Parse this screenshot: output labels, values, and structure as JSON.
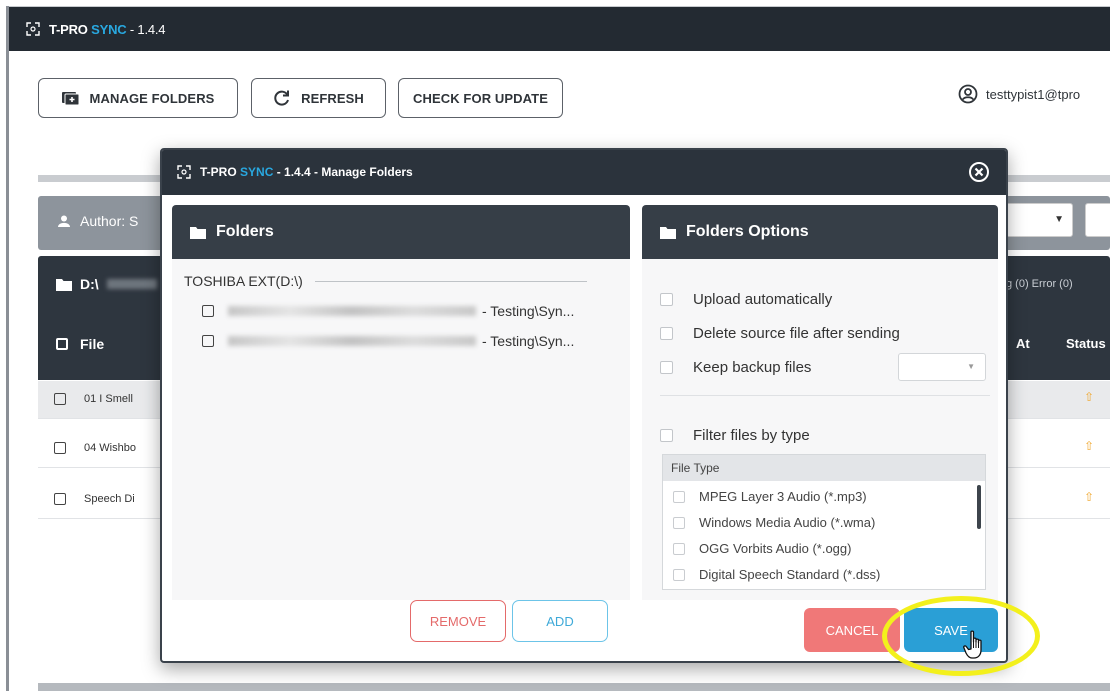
{
  "app": {
    "title_prefix": "T-PRO ",
    "title_brand": "SYNC",
    "title_version": " - 1.4.4"
  },
  "toolbar": {
    "manage_folders_label": "MANAGE FOLDERS",
    "refresh_label": "REFRESH",
    "check_update_label": "CHECK FOR UPDATE"
  },
  "user": {
    "email": "testtypist1@tpro"
  },
  "background": {
    "author_label": "Author: S",
    "folder_prefix": "D:\\",
    "counts": "g (0)  Error (0)",
    "col_file": "File",
    "col_at": "At",
    "col_status": "Status",
    "rows": [
      "01 I Smell",
      "04 Wishbo",
      "Speech Di"
    ]
  },
  "modal": {
    "title_prefix": "T-PRO ",
    "title_brand": "SYNC",
    "title_rest": " - 1.4.4 - Manage Folders",
    "folders_panel": {
      "heading": "Folders",
      "root": "TOSHIBA EXT(D:\\)",
      "items": [
        "- Testing\\Syn...",
        "- Testing\\Syn..."
      ],
      "remove_label": "REMOVE",
      "add_label": "ADD"
    },
    "options_panel": {
      "heading": "Folders Options",
      "upload_auto": "Upload automatically",
      "delete_source": "Delete source file after sending",
      "keep_backup": "Keep backup files",
      "filter_type": "Filter files by type",
      "file_type_header": "File Type",
      "file_types": [
        "MPEG Layer 3 Audio (*.mp3)",
        "Windows Media Audio (*.wma)",
        "OGG Vorbits Audio (*.ogg)",
        "Digital Speech Standard (*.dss)"
      ]
    },
    "cancel_label": "CANCEL",
    "save_label": "SAVE"
  },
  "colors": {
    "appbar": "#232a32",
    "brand_accent": "#29a8e0",
    "save_button": "#2a9fd6",
    "cancel_button": "#f07878",
    "highlight": "#f3f01c"
  },
  "icons": [
    "tpro-logo-icon",
    "add-folder-icon",
    "refresh-icon",
    "user-circle-icon",
    "close-circle-icon",
    "folder-icon",
    "user-icon",
    "hand-cursor-icon",
    "upload-arrow-icon"
  ]
}
